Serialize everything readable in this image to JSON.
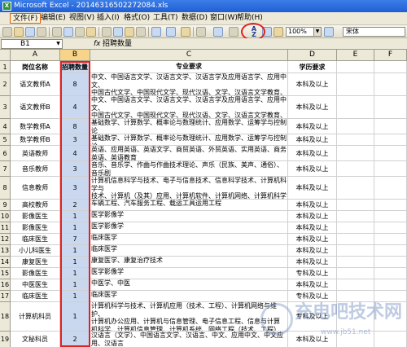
{
  "window": {
    "title": "Microsoft Excel - 20146316502272084.xls"
  },
  "menu": [
    "文件(F)",
    "编辑(E)",
    "视图(V)",
    "插入(I)",
    "格式(O)",
    "工具(T)",
    "数据(D)",
    "窗口(W)",
    "帮助(H)"
  ],
  "toolbar": {
    "zoom": "100%",
    "font": "宋体",
    "sort_icon": "sort-ascending-icon"
  },
  "formula_bar": {
    "cell_ref": "B1",
    "fx": "fx",
    "content": "招聘数量"
  },
  "columns": [
    "A",
    "B",
    "C",
    "D",
    "E",
    "F"
  ],
  "rows": [
    {
      "n": "1",
      "a": "岗位名称",
      "b": "招聘数量",
      "c": "专业要求",
      "d": "学历要求"
    },
    {
      "n": "2",
      "a": "语文教师A",
      "b": "8",
      "c": "中文、中国语言文学、汉语言文学、汉语言学及应用语言学、应用中文、\n中国古代文学、中国现代文学、现代汉语、文学、汉语言文学教育、汉语\n言、中国现当代文学、汉语言、中文教育",
      "d": "本科及以上"
    },
    {
      "n": "3",
      "a": "语文教师B",
      "b": "4",
      "c": "中文、中国语言文学、汉语言文学、汉语言学及应用语言学、应用中文、\n中国古代文学、中国现代文学、现代汉语、文学、汉语言文学教育、汉语\n言、中国现当代文学、汉语言、中文教育",
      "d": "本科及以上"
    },
    {
      "n": "4",
      "a": "数学教师A",
      "b": "8",
      "c": "基础数学、计算数学、概率论与数理统计、应用数学、运筹学与控制论\n、数学教育",
      "d": "本科及以上"
    },
    {
      "n": "5",
      "a": "数学教师B",
      "b": "3",
      "c": "基础数学、计算数学、概率论与数理统计、应用数学、运筹学与控制论\n、数学教育",
      "d": "本科及以上"
    },
    {
      "n": "6",
      "a": "英语教师",
      "b": "4",
      "c": "英语、应用英语、英语文学、商贸英语、外贸英语、实用英语、商务\n英语、英语教育",
      "d": "本科及以上"
    },
    {
      "n": "7",
      "a": "音乐教师",
      "b": "3",
      "c": "音乐、音乐学、作曲与作曲技术理论、声乐（民族、美声、通俗）、音乐剧\n、音乐表演、音乐教育、乐理、视唱练耳、音乐欣赏",
      "d": "本科及以上"
    },
    {
      "n": "8",
      "a": "信息教师",
      "b": "3",
      "c": "计算机信息科学与技术、电子与信息技术、信息科学技术、计算机科学与\n技术、计算机（及其）应用、计算机软件、计算机网络、计算机科学与技术、计算\n机与信息管理、信息与计算机科学、计算机教育、计算机多媒体",
      "d": "本科及以上"
    },
    {
      "n": "9",
      "a": "高校教师",
      "b": "2",
      "c": "车辆工程、汽车服务工程、载运工具运用工程",
      "d": "本科及以上"
    },
    {
      "n": "10",
      "a": "影像医生",
      "b": "1",
      "c": "医学影像学",
      "d": "本科及以上"
    },
    {
      "n": "11",
      "a": "影像医生",
      "b": "1",
      "c": "医学影像学",
      "d": "本科及以上"
    },
    {
      "n": "12",
      "a": "临床医生",
      "b": "7",
      "c": "临床医学",
      "d": "本科及以上"
    },
    {
      "n": "13",
      "a": "小儿科医生",
      "b": "1",
      "c": "临床医学",
      "d": "本科及以上"
    },
    {
      "n": "14",
      "a": "康复医生",
      "b": "1",
      "c": "康复医学、康复治疗技术",
      "d": "本科及以上"
    },
    {
      "n": "15",
      "a": "影像医生",
      "b": "1",
      "c": "医学影像学",
      "d": "专科及以上"
    },
    {
      "n": "16",
      "a": "中医医生",
      "b": "1",
      "c": "中医学、中医",
      "d": "本科及以上"
    },
    {
      "n": "17",
      "a": "临床医生",
      "b": "1",
      "c": "临床医学",
      "d": "专科及以上"
    },
    {
      "n": "18",
      "a": "计算机科员",
      "b": "1",
      "c": "计算机科学与技术、计算机应用（技术、工程）、计算机网络与维护、\n计算机办公应用、计算机与信息管理、电子信息工程、信息与计算\n机科学、计算机信息管理、计算机系统、网络工程（技术、工程）\n（技术）、软件工程、计算机软件技术",
      "d": "专科及以上"
    },
    {
      "n": "19",
      "a": "文秘科员",
      "b": "2",
      "c": "汉语言（文学）、中国语言文学、汉语言、中文、应用中文、中文应用、汉语言\n文学、文秘、秘书（学）、文秘教育",
      "d": "本科及以上"
    }
  ],
  "watermark": {
    "text": "充电吧技术网",
    "url": "www.jb51.net"
  }
}
